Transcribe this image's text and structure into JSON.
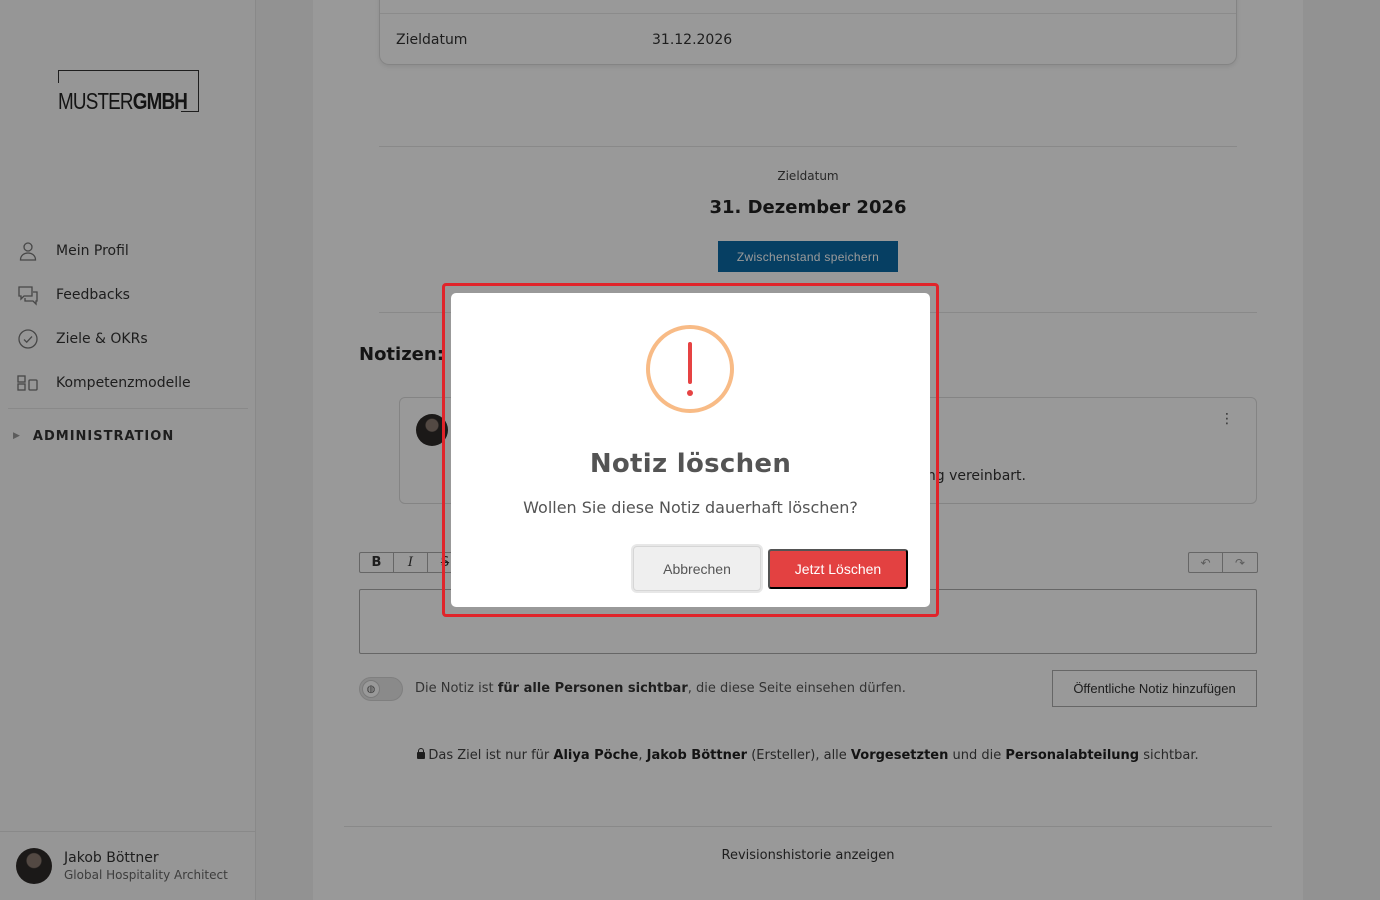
{
  "brand": {
    "logo_light": "MUSTER",
    "logo_bold": "GMBH"
  },
  "sidebar": {
    "items": [
      {
        "label": "Mein Profil",
        "icon": "person-icon"
      },
      {
        "label": "Feedbacks",
        "icon": "chat-bubbles-icon"
      },
      {
        "label": "Ziele & OKRs",
        "icon": "check-circle-icon"
      },
      {
        "label": "Kompetenzmodelle",
        "icon": "blocks-icon"
      }
    ],
    "admin_label": "ADMINISTRATION"
  },
  "user": {
    "name": "Jakob Böttner",
    "role": "Global Hospitality Architect"
  },
  "goal": {
    "table_key": "Zieldatum",
    "table_value": "31.12.2026",
    "target_label": "Zieldatum",
    "target_value": "31. Dezember 2026",
    "save_button": "Zwischenstand speichern"
  },
  "notes": {
    "title": "Notizen:",
    "visible_note_text": "ung vereinbart.",
    "menu_glyph": "⋮",
    "toolbar": {
      "bold": "B",
      "italic": "I",
      "strike": "S",
      "undo": "↶",
      "redo": "↷"
    },
    "visibility_pre": "Die Notiz ist ",
    "visibility_bold": "für alle Personen sichtbar",
    "visibility_post": ", die diese Seite einsehen dürfen.",
    "add_button": "Öffentliche Notiz hinzufügen"
  },
  "privacy": {
    "p1": "Das Ziel ist nur für ",
    "b1": "Aliya Pöche",
    "p2": ", ",
    "b2": "Jakob Böttner",
    "p3": " (Ersteller), alle ",
    "b3": "Vorgesetzten",
    "p4": " und die ",
    "b4": "Personalabteilung",
    "p5": " sichtbar."
  },
  "revision_link": "Revisionshistorie anzeigen",
  "modal": {
    "title": "Notiz löschen",
    "text": "Wollen Sie diese Notiz dauerhaft löschen?",
    "cancel": "Abbrechen",
    "confirm": "Jetzt Löschen",
    "icon": "warning-icon"
  },
  "colors": {
    "primary": "#0b6aa6",
    "danger": "#e34141",
    "warning_ring": "#f8bb86",
    "highlight": "#e0242a"
  }
}
